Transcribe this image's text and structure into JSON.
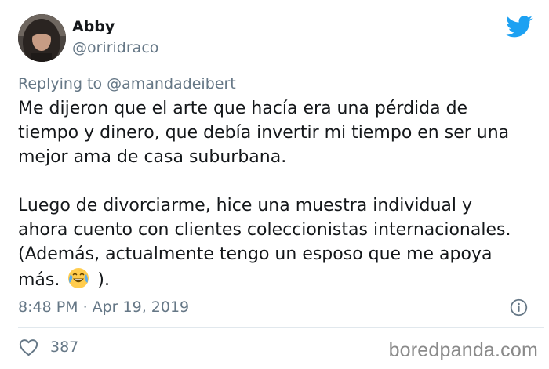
{
  "author": {
    "name": "Abby",
    "handle": "@oriridraco"
  },
  "reply": {
    "prefix": "Replying to",
    "handle": "@amandadeibert"
  },
  "tweet": {
    "lines_p1": [
      "Me dijeron que el arte que hacía era una pérdida de",
      "tiempo y dinero, que debía invertir mi tiempo en ser una",
      "mejor ama de casa suburbana."
    ],
    "lines_p2": [
      "Luego de divorciarme, hice una muestra individual y",
      "ahora cuento con clientes coleccionistas internacionales.",
      "(Además, actualmente tengo un esposo que me apoya"
    ],
    "last_line_before_emoji": "más.",
    "emoji": "face-with-tears-of-joy",
    "last_line_after_emoji": ")."
  },
  "meta": {
    "time": "8:48 PM",
    "separator": "·",
    "date": "Apr 19, 2019"
  },
  "stats": {
    "likes": "387"
  },
  "watermark": "boredpanda.com",
  "icons": {
    "brand": "twitter-bird-icon",
    "info": "info-icon",
    "like": "heart-icon"
  },
  "colors": {
    "twitter_blue": "#1DA1F2",
    "secondary_text": "#657786",
    "primary_text": "#14171A",
    "divider": "#E1E8ED"
  }
}
